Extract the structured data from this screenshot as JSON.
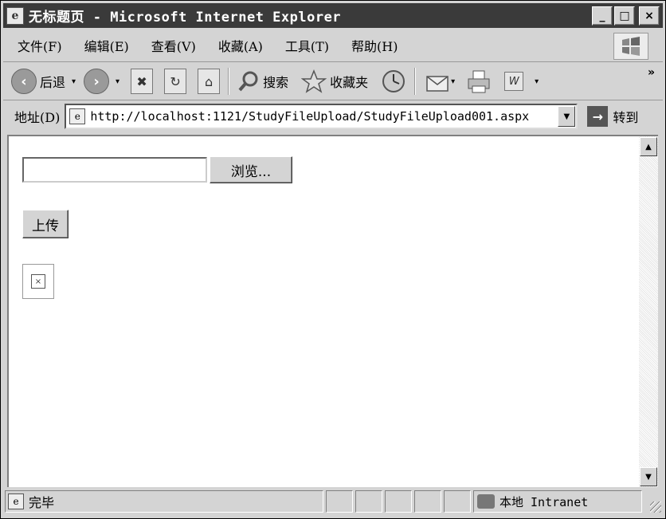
{
  "window": {
    "title": "无标题页 - Microsoft Internet Explorer",
    "buttons": {
      "minimize": "_",
      "maximize": "□",
      "close": "×"
    }
  },
  "menu": [
    "文件(F)",
    "编辑(E)",
    "查看(V)",
    "收藏(A)",
    "工具(T)",
    "帮助(H)"
  ],
  "toolbar": {
    "back_label": "后退",
    "search_label": "搜索",
    "favorites_label": "收藏夹",
    "more": "»"
  },
  "address": {
    "label": "地址(D)",
    "url": "http://localhost:1121/StudyFileUpload/StudyFileUpload001.aspx",
    "go_label": "转到"
  },
  "page": {
    "file_input_value": "",
    "browse_label": "浏览...",
    "upload_label": "上传"
  },
  "status": {
    "text": "完毕",
    "zone": "本地 Intranet"
  }
}
